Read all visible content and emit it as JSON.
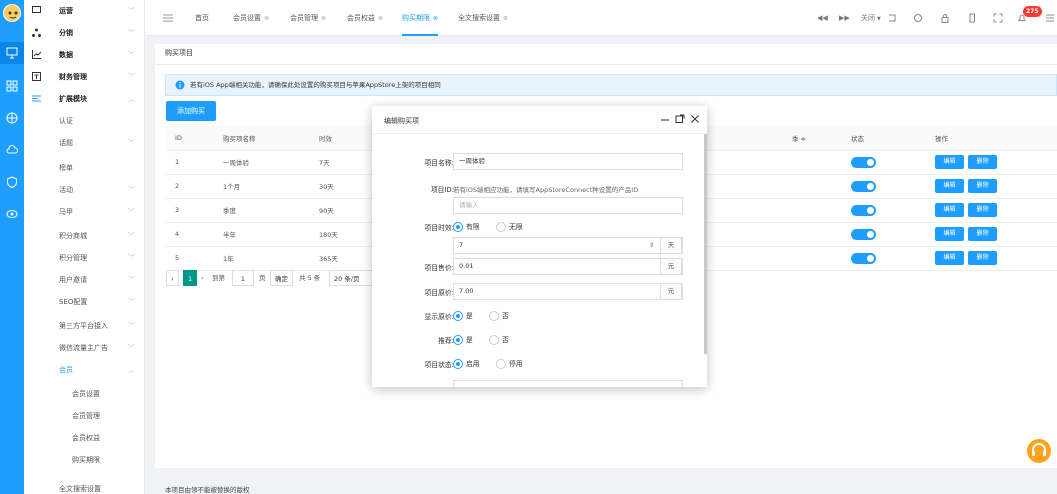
{
  "colors": {
    "accent": "#1e9fff",
    "rail": "#1e9fff",
    "danger": "#ff3a30",
    "page_current": "#009688"
  },
  "rail_icons": [
    "avatar-icon",
    "monitor-icon",
    "grid-icon",
    "globe-icon",
    "cloud-icon",
    "shield-icon",
    "eye-icon"
  ],
  "sidebar": {
    "items": [
      {
        "label": "运营",
        "icon": "monitor-small-icon"
      },
      {
        "label": "分销",
        "icon": "network-icon"
      },
      {
        "label": "数据",
        "icon": "chart-icon"
      },
      {
        "label": "财务管理",
        "icon": "finance-icon"
      },
      {
        "label": "扩展模块",
        "icon": "extend-icon"
      },
      {
        "label": "认证"
      },
      {
        "label": "话题"
      },
      {
        "label": "榜单"
      },
      {
        "label": "活动"
      },
      {
        "label": "马甲"
      },
      {
        "label": "积分商城"
      },
      {
        "label": "积分管理"
      },
      {
        "label": "用户邀请"
      },
      {
        "label": "SEO配置"
      },
      {
        "label": "第三方平台接入"
      },
      {
        "label": "微信流量主广告"
      },
      {
        "label": "会员"
      },
      {
        "label": "会员设置"
      },
      {
        "label": "会员管理"
      },
      {
        "label": "会员权益"
      },
      {
        "label": "购买期限"
      },
      {
        "label": "全文搜索设置"
      }
    ]
  },
  "tabs": [
    {
      "label": "首页"
    },
    {
      "label": "会员设置"
    },
    {
      "label": "会员管理"
    },
    {
      "label": "会员权益"
    },
    {
      "label": "购买期限"
    },
    {
      "label": "全文搜索设置"
    }
  ],
  "topbar": {
    "close_label": "关闭",
    "badge": "275"
  },
  "card": {
    "title": "购买项目"
  },
  "notice": "若有iOS App端相关功能，请确保此处设置的购买项目与苹果AppStore上架的项目相同",
  "add_button": "添加购买",
  "table": {
    "headers": [
      "ID",
      "购买项名称",
      "时效",
      "季 ≑",
      "状态",
      "操作"
    ],
    "rows": [
      {
        "id": "1",
        "name": "一周体验",
        "period": "7天"
      },
      {
        "id": "2",
        "name": "1个月",
        "period": "30天"
      },
      {
        "id": "3",
        "name": "季度",
        "period": "90天"
      },
      {
        "id": "4",
        "name": "半年",
        "period": "180天"
      },
      {
        "id": "5",
        "name": "1年",
        "period": "365天"
      }
    ],
    "edit_label": "编辑",
    "delete_label": "删除"
  },
  "pager": {
    "current": "1",
    "goto": "到第",
    "page_input": "1",
    "page_unit": "页",
    "confirm": "确定",
    "total": "共 5 条",
    "per_page": "20 条/页"
  },
  "footer": "本项目由领不能被替换的版权",
  "modal": {
    "title": "编辑购买项",
    "name_label": "项目名称:",
    "name_value": "一周体验",
    "id_label": "项目ID:",
    "id_hint": "若有iOS端相应功能，请填写AppStoreConnect种设置的产品ID",
    "id_placeholder": "请输入",
    "period_label": "项目时效:",
    "period_opts": [
      "有限",
      "无限"
    ],
    "period_value": "7",
    "period_unit": "天",
    "price_label": "项目售价:",
    "price_value": "0.01",
    "price_unit": "元",
    "orig_label": "项目原价:",
    "orig_value": "7.00",
    "orig_unit": "元",
    "show_orig_label": "显示原价:",
    "yesno": [
      "是",
      "否"
    ],
    "recommend_label": "推荐:",
    "status_label": "项目状态:",
    "status_opts": [
      "启用",
      "停用"
    ]
  }
}
